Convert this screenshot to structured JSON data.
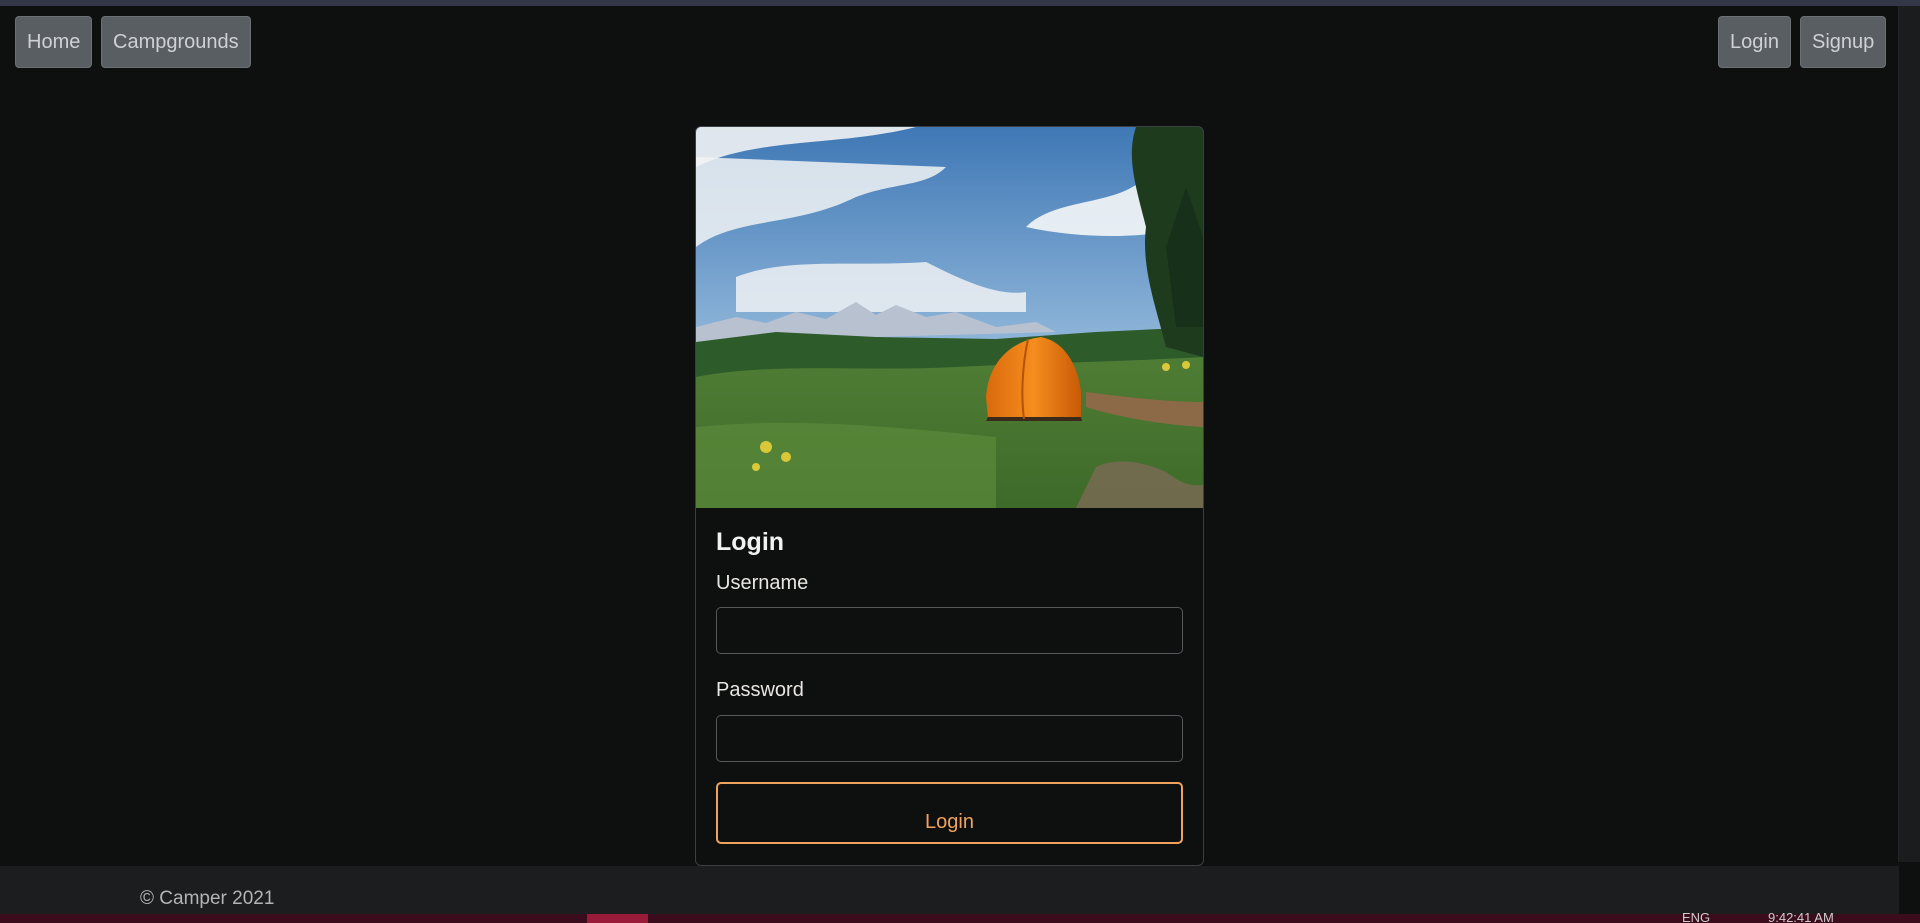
{
  "nav": {
    "home_label": "Home",
    "campgrounds_label": "Campgrounds",
    "login_label": "Login",
    "signup_label": "Signup"
  },
  "login_card": {
    "image": "campground-tent-photo",
    "title": "Login",
    "username_label": "Username",
    "username_value": "",
    "password_label": "Password",
    "password_value": "",
    "submit_label": "Login"
  },
  "footer": {
    "copyright": "© Camper 2021"
  },
  "taskbar": {
    "language": "ENG",
    "time": "9:42:41 AM"
  },
  "colors": {
    "background": "#0e0f0f",
    "nav_button": "#595e63",
    "accent": "#f0a35e",
    "footer": "#1b1d1f",
    "taskbar": "#3b0d1c"
  }
}
